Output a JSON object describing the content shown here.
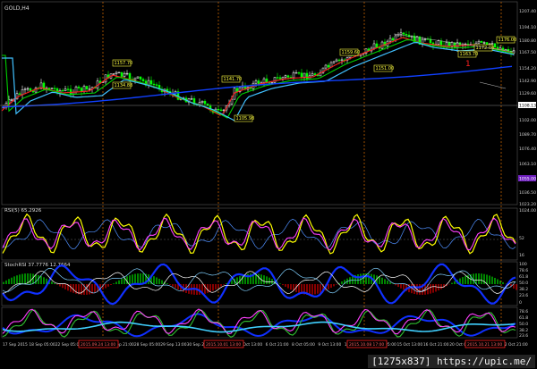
{
  "window": {
    "symbol_label": "GOLD,H4"
  },
  "indicators": {
    "rsi_label": "RSI(5) 65.2926",
    "stoch_label": "StochRSI 37.7776 12.7664",
    "panel3_label": ""
  },
  "price_axis": {
    "ticks": [
      "1207.40",
      "1194.10",
      "1180.80",
      "1167.50",
      "1154.20",
      "1142.90",
      "1129.60",
      "1116.30",
      "1102.00",
      "1089.70",
      "1076.40",
      "1063.10",
      "1049.80",
      "1036.50",
      "1023.20"
    ],
    "current_price": "1108.13",
    "secondary_marker": "1055.00"
  },
  "rsi_axis": {
    "ticks": [
      "1024.00",
      "52",
      "16"
    ]
  },
  "stoch_axis": {
    "ticks": [
      "100",
      "78.6",
      "61.8",
      "50.0",
      "38.2",
      "23.6",
      "0"
    ]
  },
  "p3_axis": {
    "ticks": [
      "78.6",
      "61.8",
      "50.0",
      "38.2",
      "23.6"
    ]
  },
  "time_axis": {
    "labels": [
      "17 Sep 2015",
      "18 Sep 05:00",
      "22 Sep 05:00",
      "23 Sep 13:00",
      "24 Sep 21:00",
      "28 Sep 05:00",
      "29 Sep 13:00",
      "30 Sep 21:00",
      "2 Oct 05:00",
      "5 Oct 13:00",
      "6 Oct 21:00",
      "8 Oct 05:00",
      "9 Oct 13:00",
      "12 Oct 21:00",
      "14 Oct 05:00",
      "15 Oct 13:00",
      "16 Oct 21:00",
      "20 Oct 05:00",
      "21 Oct 13:00",
      "22 Oct 21:00"
    ],
    "highlighted": [
      "2015.09.24 13:00",
      "2015.10.01 13:00",
      "2015.10.08 17:00",
      "2015.10.21 13:00"
    ]
  },
  "price_labels": [
    "1157.70",
    "1134.88",
    "1141.70",
    "1105.98",
    "1159.60",
    "1151.00",
    "1176.00",
    "1163.70",
    "1172.04"
  ],
  "red_marker": "1",
  "watermark": "[1275x837] https://upic.me/",
  "colors": {
    "background": "#000000",
    "grid": "#2a2a2a",
    "candle_up": "#ffffff",
    "candle_down": "#00ff00",
    "ma_red": "#ff2020",
    "ma_green": "#00d000",
    "ma_cyan": "#40c0ff",
    "ma_blue": "#1040ff",
    "label_bg": "#ffff40",
    "vline": "#ff8000",
    "magenta": "#ff40ff",
    "yellow": "#ffff00"
  }
}
